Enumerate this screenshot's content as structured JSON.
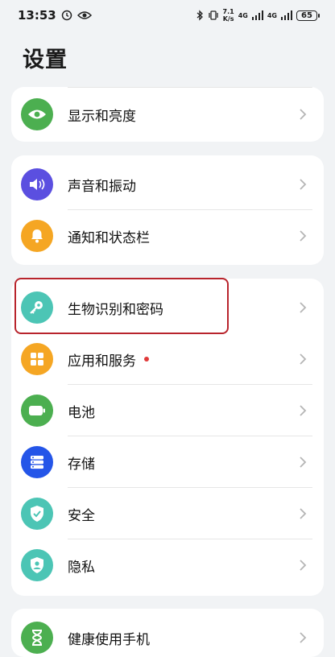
{
  "status": {
    "time": "13:53",
    "net_speed_top": "7.1",
    "net_speed_unit": "K/s",
    "sim1": "4G",
    "sim2": "4G",
    "battery": "65"
  },
  "title": "设置",
  "items": [
    {
      "label": "显示和亮度",
      "icon": "eye-icon",
      "color": "#4caf50"
    },
    {
      "label": "声音和振动",
      "icon": "speaker-icon",
      "color": "#5b4fe0"
    },
    {
      "label": "通知和状态栏",
      "icon": "bell-icon",
      "color": "#f5a623"
    },
    {
      "label": "生物识别和密码",
      "icon": "key-icon",
      "color": "#4cc5b5"
    },
    {
      "label": "应用和服务",
      "icon": "apps-grid-icon",
      "color": "#f5a623"
    },
    {
      "label": "电池",
      "icon": "battery-icon",
      "color": "#4caf50"
    },
    {
      "label": "存储",
      "icon": "storage-icon",
      "color": "#2455e8"
    },
    {
      "label": "安全",
      "icon": "shield-icon",
      "color": "#4cc5b5"
    },
    {
      "label": "隐私",
      "icon": "privacy-icon",
      "color": "#4cc5b5"
    },
    {
      "label": "健康使用手机",
      "icon": "hourglass-icon",
      "color": "#4caf50"
    }
  ]
}
